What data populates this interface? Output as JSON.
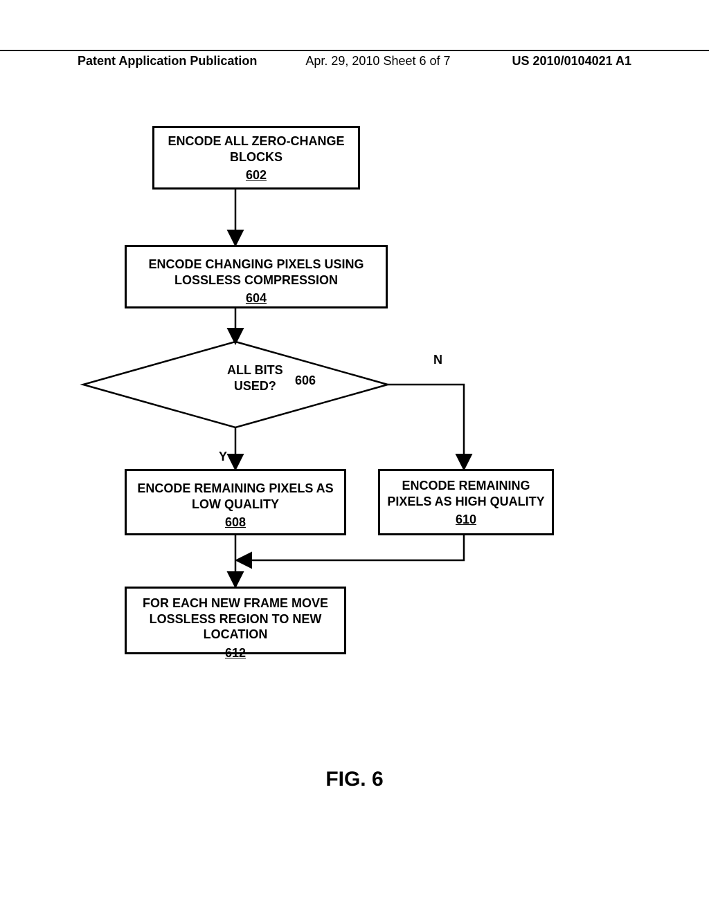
{
  "header": {
    "left": "Patent Application Publication",
    "mid": "Apr. 29, 2010  Sheet 6 of 7",
    "right": "US 2010/0104021 A1"
  },
  "boxes": {
    "b602": {
      "text": "ENCODE ALL ZERO-CHANGE BLOCKS",
      "ref": "602"
    },
    "b604": {
      "text": "ENCODE CHANGING PIXELS USING LOSSLESS COMPRESSION",
      "ref": "604"
    },
    "b608": {
      "text": "ENCODE REMAINING PIXELS AS LOW QUALITY",
      "ref": "608"
    },
    "b610": {
      "text": "ENCODE REMAINING PIXELS AS HIGH QUALITY",
      "ref": "610"
    },
    "b612": {
      "text": "FOR EACH NEW FRAME MOVE LOSSLESS REGION TO NEW LOCATION",
      "ref": "612"
    }
  },
  "decision": {
    "line1": "ALL BITS",
    "line2": "USED?",
    "ref": "606"
  },
  "labels": {
    "N": "N",
    "Y": "Y"
  },
  "figure": "FIG. 6",
  "chart_data": {
    "type": "flowchart",
    "nodes": [
      {
        "id": "602",
        "type": "process",
        "text": "ENCODE ALL ZERO-CHANGE BLOCKS"
      },
      {
        "id": "604",
        "type": "process",
        "text": "ENCODE CHANGING PIXELS USING LOSSLESS COMPRESSION"
      },
      {
        "id": "606",
        "type": "decision",
        "text": "ALL BITS USED?"
      },
      {
        "id": "608",
        "type": "process",
        "text": "ENCODE REMAINING PIXELS AS LOW QUALITY"
      },
      {
        "id": "610",
        "type": "process",
        "text": "ENCODE REMAINING PIXELS AS HIGH QUALITY"
      },
      {
        "id": "612",
        "type": "process",
        "text": "FOR EACH NEW FRAME MOVE LOSSLESS REGION TO NEW LOCATION"
      }
    ],
    "edges": [
      {
        "from": "602",
        "to": "604",
        "label": ""
      },
      {
        "from": "604",
        "to": "606",
        "label": ""
      },
      {
        "from": "606",
        "to": "608",
        "label": "Y"
      },
      {
        "from": "606",
        "to": "610",
        "label": "N"
      },
      {
        "from": "608",
        "to": "612",
        "label": ""
      },
      {
        "from": "610",
        "to": "612",
        "label": ""
      }
    ]
  }
}
